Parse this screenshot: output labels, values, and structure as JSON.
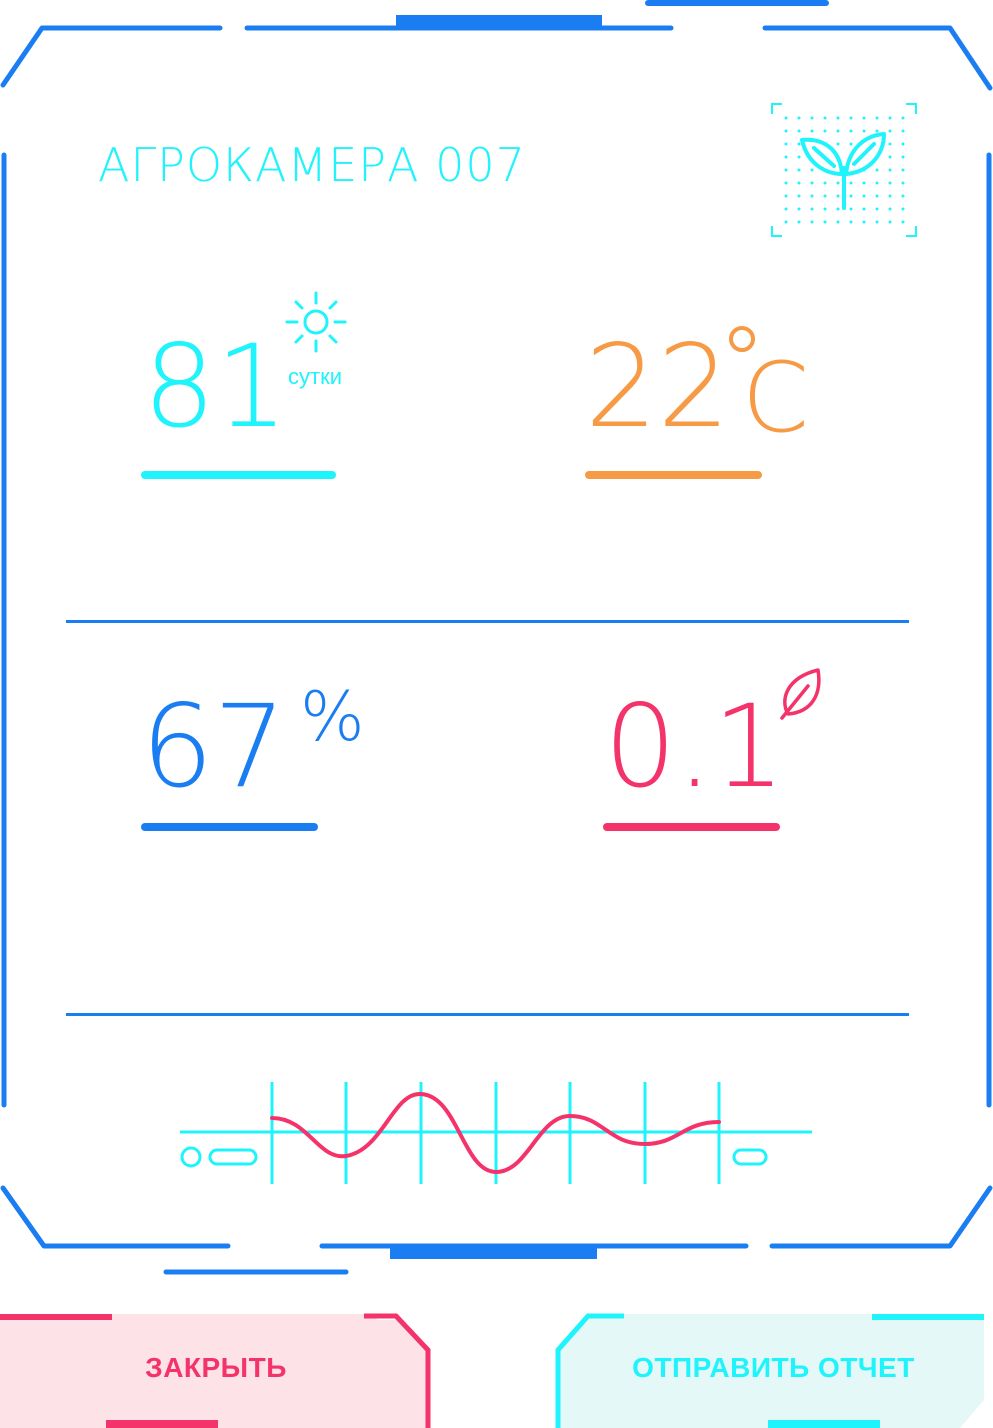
{
  "header": {
    "title": "АГРОКАМЕРА 007"
  },
  "metrics": {
    "days": {
      "value": "81",
      "unit": "сутки",
      "icon": "sun-icon"
    },
    "temperature": {
      "value": "22",
      "unit": "C",
      "icon": "degree-icon"
    },
    "humidity": {
      "value": "67",
      "unit": "%"
    },
    "co2": {
      "value": "0.1",
      "icon": "leaf-icon"
    }
  },
  "buttons": {
    "close_label": "ЗАКРЫТЬ",
    "send_label": "ОТПРАВИТЬ ОТЧЕТ"
  },
  "icons": {
    "camera": "plant-camera-icon"
  },
  "colors": {
    "cyan": "#1ff3fb",
    "blue": "#1a7ef2",
    "orange": "#f79a45",
    "pink": "#f3336a",
    "close_bg": "#fde2e8",
    "send_bg": "#e4f8f8"
  }
}
